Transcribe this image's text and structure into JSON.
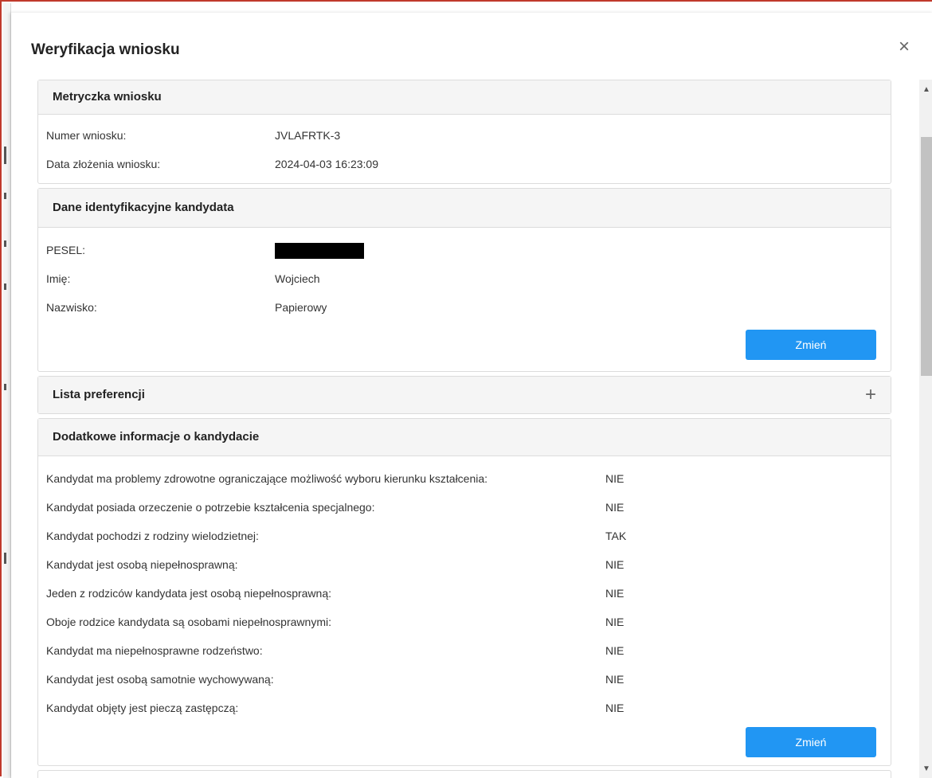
{
  "modal": {
    "title": "Weryfikacja wniosku",
    "close_icon": "×"
  },
  "metryczka": {
    "header": "Metryczka wniosku",
    "rows": [
      {
        "label": "Numer wniosku:",
        "value": "JVLAFRTK-3"
      },
      {
        "label": "Data złożenia wniosku:",
        "value": "2024-04-03 16:23:09"
      }
    ]
  },
  "dane": {
    "header": "Dane identyfikacyjne kandydata",
    "pesel_label": "PESEL:",
    "imie_label": "Imię:",
    "imie_value": "Wojciech",
    "nazwisko_label": "Nazwisko:",
    "nazwisko_value": "Papierowy",
    "button": "Zmień"
  },
  "preferencje": {
    "header": "Lista preferencji",
    "expand_icon": "+"
  },
  "dodatkowe": {
    "header": "Dodatkowe informacje o kandydacie",
    "rows": [
      {
        "label": "Kandydat ma problemy zdrowotne ograniczające możliwość wyboru kierunku kształcenia:",
        "value": "NIE"
      },
      {
        "label": "Kandydat posiada orzeczenie o potrzebie kształcenia specjalnego:",
        "value": "NIE"
      },
      {
        "label": "Kandydat pochodzi z rodziny wielodzietnej:",
        "value": "TAK"
      },
      {
        "label": "Kandydat jest osobą niepełnosprawną:",
        "value": "NIE"
      },
      {
        "label": "Jeden z rodziców kandydata jest osobą niepełnosprawną:",
        "value": "NIE"
      },
      {
        "label": "Oboje rodzice kandydata są osobami niepełnosprawnymi:",
        "value": "NIE"
      },
      {
        "label": "Kandydat ma niepełnosprawne rodzeństwo:",
        "value": "NIE"
      },
      {
        "label": "Kandydat jest osobą samotnie wychowywaną:",
        "value": "NIE"
      },
      {
        "label": "Kandydat objęty jest pieczą zastępczą:",
        "value": "NIE"
      }
    ],
    "button": "Zmień"
  },
  "scrollbar": {
    "up_icon": "▲",
    "down_icon": "▼"
  }
}
